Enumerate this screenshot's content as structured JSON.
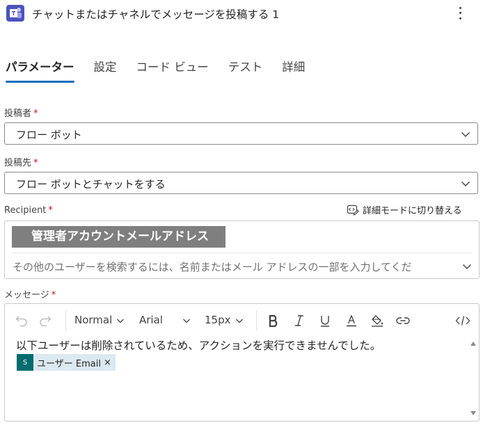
{
  "header": {
    "title": "チャットまたはチャネルでメッセージを投稿する 1",
    "app_icon": "teams-icon",
    "brand_color": "#4b53bc"
  },
  "tabs": [
    {
      "label": "パラメーター",
      "active": true
    },
    {
      "label": "設定",
      "active": false
    },
    {
      "label": "コード ビュー",
      "active": false
    },
    {
      "label": "テスト",
      "active": false
    },
    {
      "label": "詳細",
      "active": false
    }
  ],
  "accent_color": "#0f6cbd",
  "fields": {
    "post_as": {
      "label": "投稿者",
      "required_mark": "*",
      "value": "フロー ボット"
    },
    "post_in": {
      "label": "投稿先",
      "required_mark": "*",
      "value": "フロー ボットとチャットをする"
    },
    "recipient": {
      "label": "Recipient",
      "required_mark": "*",
      "advanced_mode_label": "詳細モードに切り替える",
      "selected_value": "管理者アカウントメールアドレス",
      "placeholder": "その他のユーザーを検索するには、名前またはメール アドレスの一部を入力してくだ"
    },
    "message": {
      "label": "メッセージ",
      "required_mark": "*",
      "toolbar": {
        "paragraph_style": "Normal",
        "font": "Arial",
        "font_size": "15px"
      },
      "body_text": "以下ユーザーは削除されているため、アクションを実行できませんでした。",
      "token": {
        "label": "ユーザー Email",
        "remove": "×",
        "icon": "sharepoint-icon",
        "icon_text": "S"
      }
    }
  }
}
